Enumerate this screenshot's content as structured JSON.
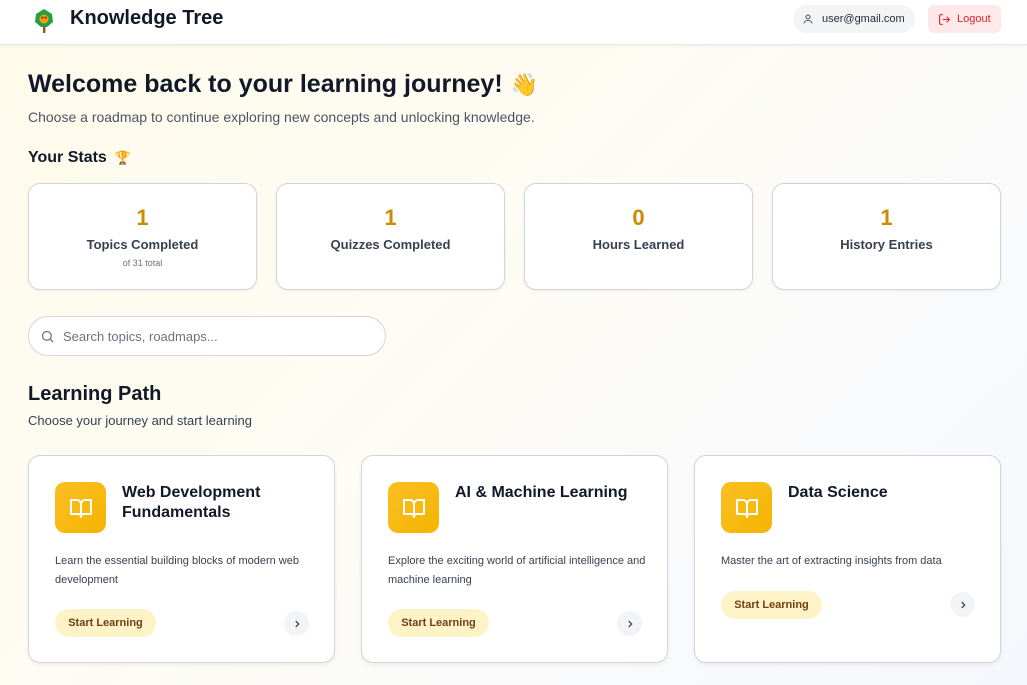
{
  "header": {
    "app_title": "Knowledge Tree",
    "user_email": "user@gmail.com",
    "logout_label": "Logout"
  },
  "welcome": {
    "title": "Welcome back to your learning journey!",
    "emoji": "👋",
    "subtitle": "Choose a roadmap to continue exploring new concepts and unlocking knowledge."
  },
  "stats": {
    "heading": "Your Stats",
    "heading_emoji": "🏆",
    "cards": [
      {
        "value": "1",
        "label": "Topics Completed",
        "sub": "of 31 total"
      },
      {
        "value": "1",
        "label": "Quizzes Completed",
        "sub": ""
      },
      {
        "value": "0",
        "label": "Hours Learned",
        "sub": ""
      },
      {
        "value": "1",
        "label": "History Entries",
        "sub": ""
      }
    ]
  },
  "search": {
    "placeholder": "Search topics, roadmaps..."
  },
  "learning_path": {
    "title": "Learning Path",
    "subtitle": "Choose your journey and start learning",
    "cards": [
      {
        "title": "Web Development Fundamentals",
        "description": "Learn the essential building blocks of modern web development",
        "button": "Start Learning"
      },
      {
        "title": "AI & Machine Learning",
        "description": "Explore the exciting world of artificial intelligence and machine learning",
        "button": "Start Learning"
      },
      {
        "title": "Data Science",
        "description": "Master the art of extracting insights from data",
        "button": "Start Learning"
      }
    ]
  },
  "colors": {
    "accent": "#ca8a04",
    "icon_bg": "#fbbf24",
    "button_bg": "#fef3c7",
    "logout": "#dc2626"
  },
  "icons": {
    "logo": "tree-logo-icon",
    "user": "user-icon",
    "logout": "logout-icon",
    "search": "search-icon",
    "book": "book-icon",
    "chevron": "chevron-right-icon"
  }
}
